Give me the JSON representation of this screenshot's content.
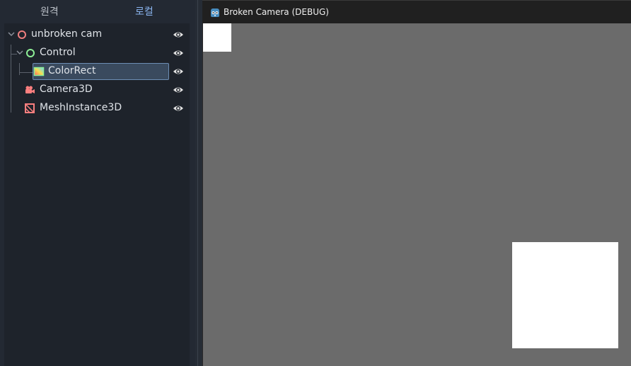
{
  "dock": {
    "tabs": [
      "원격",
      "로컬"
    ],
    "active_tab": "로컬",
    "tree": [
      {
        "label": "unbroken cam",
        "icon": "node-root-icon",
        "color": "#ee7f7f",
        "expanded": true
      },
      {
        "label": "Control",
        "icon": "control-node-icon",
        "color": "#8eef97",
        "expanded": true
      },
      {
        "label": "ColorRect",
        "icon": "colorrect-icon",
        "color": "#8eef97",
        "selected": true
      },
      {
        "label": "Camera3D",
        "icon": "camera3d-icon",
        "color": "#fc7f7f"
      },
      {
        "label": "MeshInstance3D",
        "icon": "meshinstance3d-icon",
        "color": "#fc7f7f"
      }
    ]
  },
  "window": {
    "title": "Broken Camera (DEBUG)",
    "icon": "godot-icon",
    "viewport_color": "#6b6b6b",
    "rect_color": "#ffffff"
  }
}
